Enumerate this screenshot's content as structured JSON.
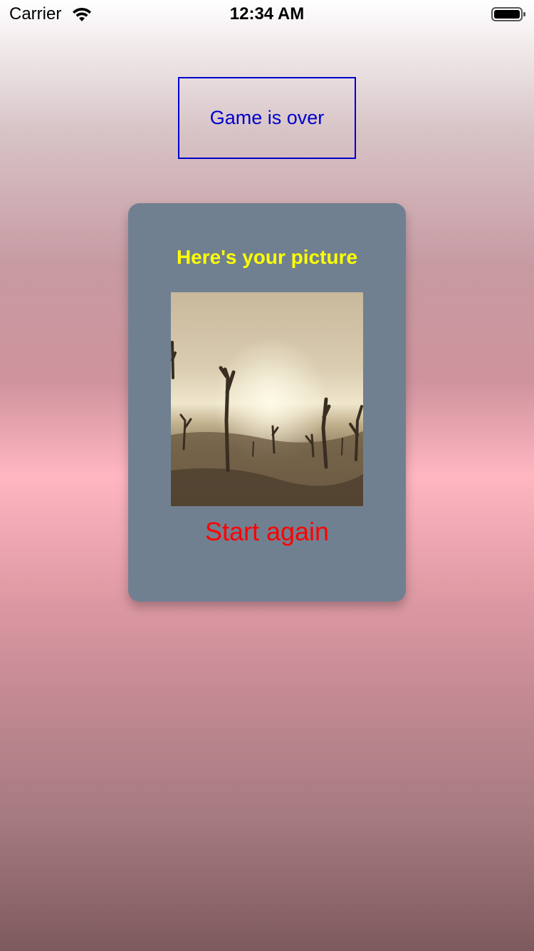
{
  "status_bar": {
    "carrier": "Carrier",
    "time": "12:34 AM",
    "icons": [
      "wifi-icon",
      "battery-icon"
    ]
  },
  "game_over": {
    "label": "Game is over",
    "color": "#0000cc"
  },
  "card": {
    "title": "Here's your picture",
    "title_color": "#ffff00",
    "background": "#708090",
    "picture": "dead-trees-landscape-image",
    "button_label": "Start again",
    "button_color": "#ff0000"
  }
}
